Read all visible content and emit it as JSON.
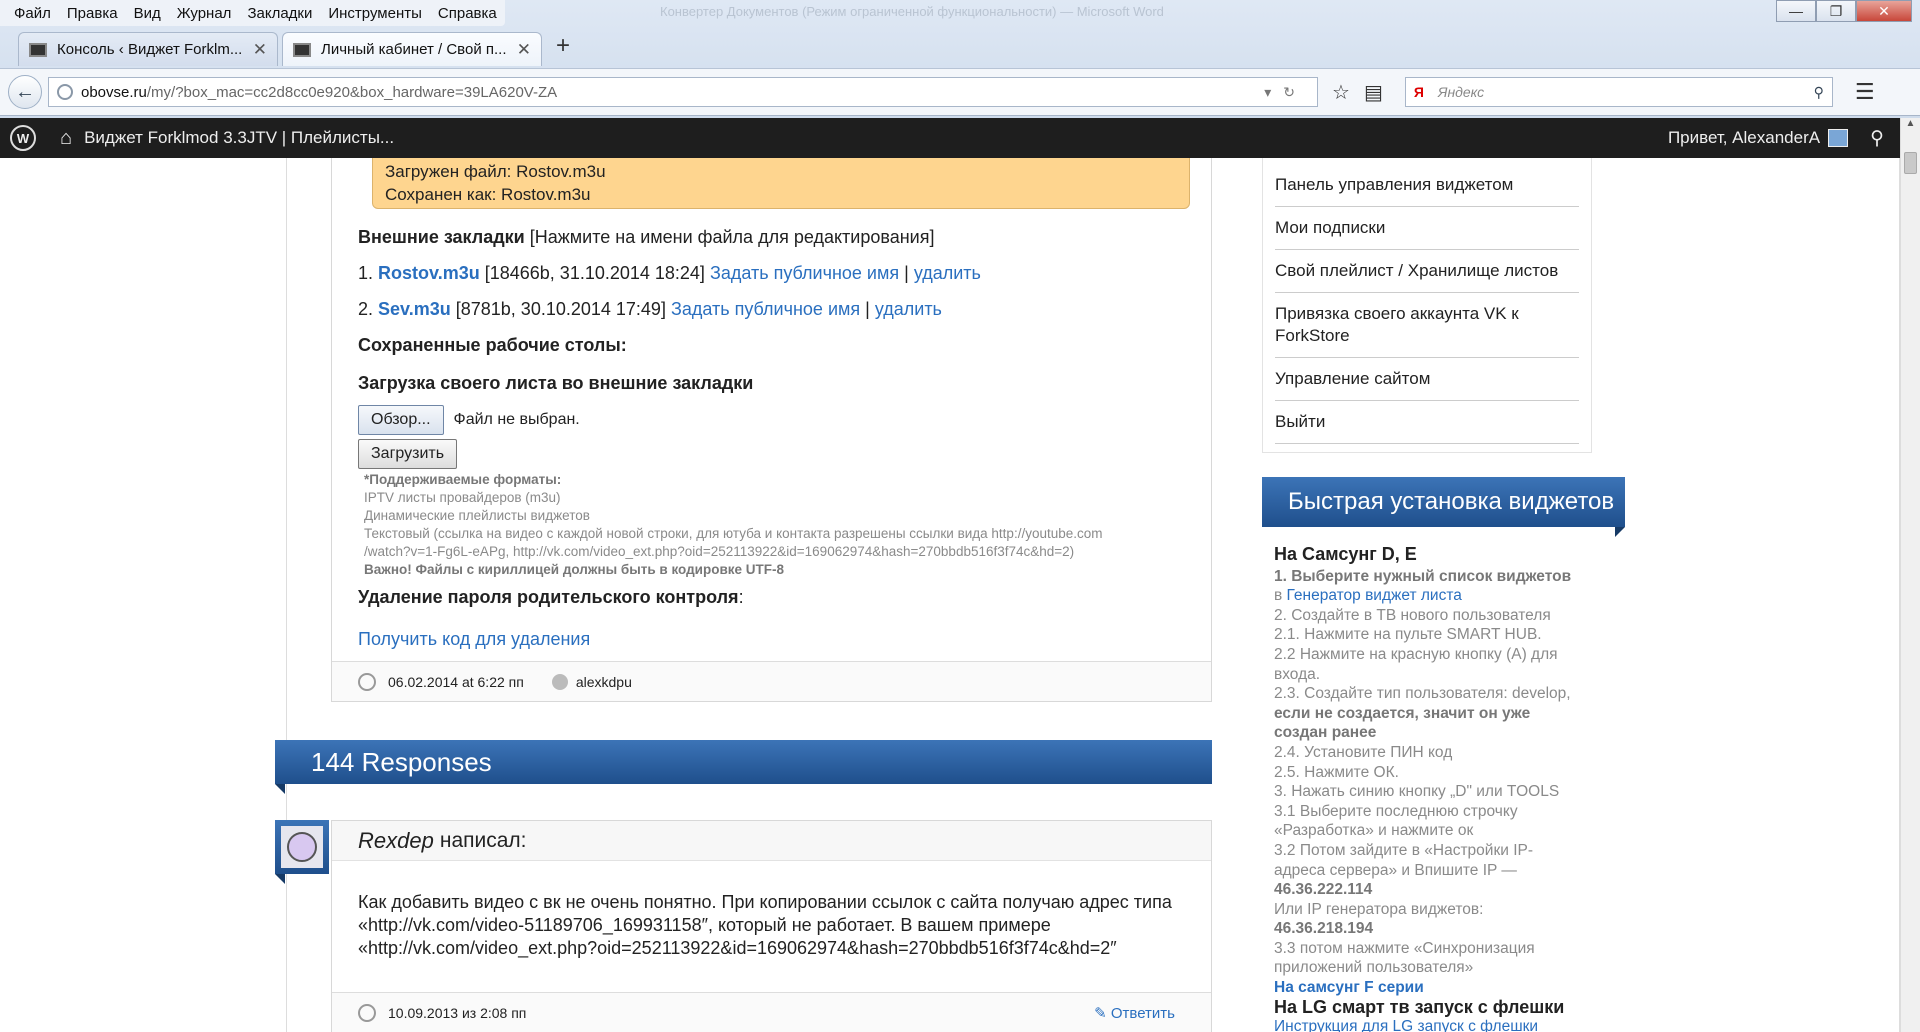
{
  "browser": {
    "menu": [
      "Файл",
      "Правка",
      "Вид",
      "Журнал",
      "Закладки",
      "Инструменты",
      "Справка"
    ],
    "window_title": "Конвертер Документов (Режим ограниченной функциональности) — Microsoft Word",
    "tabs": [
      {
        "label": "Консоль ‹ Виджет Forklm..."
      },
      {
        "label": "Личный кабинет / Свой п..."
      }
    ],
    "url_domain": "obovse.ru",
    "url_path": "/my/?box_mac=cc2d8cc0e920&box_hardware=39LA620V-ZA",
    "search_engine_label": "Я",
    "search_placeholder": "Яндекс"
  },
  "wpbar": {
    "site_name": "Виджет Forklmod 3.3JTV | Плейлисты...",
    "greeting": "Привет, AlexanderA"
  },
  "post": {
    "notice_line1": "Загружен файл: Rostov.m3u",
    "notice_line2": "Сохранен как: Rostov.m3u",
    "ext_bookmarks_title": "Внешние закладки",
    "ext_bookmarks_hint": "[Нажмите на имени файла для редактирования]",
    "files": [
      {
        "num": "1.",
        "name": "Rostov.m3u",
        "info": "[18466b, 31.10.2014 18:24]",
        "public": "Задать публичное имя",
        "sep": "|",
        "delete": "удалить"
      },
      {
        "num": "2.",
        "name": "Sev.m3u",
        "info": "[8781b, 30.10.2014 17:49]",
        "public": "Задать публичное имя",
        "sep": "|",
        "delete": "удалить"
      }
    ],
    "saved_desktops": "Сохраненные рабочие столы:",
    "upload_title": "Загрузка своего листа во внешние закладки",
    "browse_label": "Обзор...",
    "no_file": "Файл не выбран.",
    "upload_label": "Загрузить",
    "formats_title": "*Поддерживаемые форматы:",
    "formats": [
      "IPTV листы провайдеров (m3u)",
      "Динамические плейлисты виджетов",
      "Текстовый (ссылка на видео с каждой новой строки, для ютуба и контакта разрешены ссылки вида http://youtube.com",
      "/watch?v=1-Fg6L-eAPg, http://vk.com/video_ext.php?oid=252113922&id=169062974&hash=270bbdb516f3f74c&hd=2)"
    ],
    "formats_warning": "Важно! Файлы с кириллицей должны быть в кодировке UTF-8",
    "parental_title": "Удаление пароля родительского контроля",
    "parental_colon": ":",
    "get_code": "Получить код для удаления",
    "date": "06.02.2014 at 6:22 пп",
    "author": "alexkdpu"
  },
  "responses_title": "144 Responses",
  "comment": {
    "author": "Rexdep",
    "wrote": "написал:",
    "text": "Как добавить видео с вк не очень понятно. При копировании ссылок с сайта получаю адрес типа «http://vk.com/video-51189706_169931158″, который не работает. В вашем примере «http://vk.com/video_ext.php?oid=252113922&id=169062974&hash=270bbdb516f3f74c&hd=2″",
    "date": "10.09.2013 из 2:08 пп",
    "reply": "Ответить"
  },
  "sidebar": {
    "menu": [
      "Панель управления виджетом",
      "Мои подписки",
      "Свой плейлист / Хранилище листов",
      "Привязка своего аккаунта VK к ForkStore",
      "Управление сайтом",
      "Выйти"
    ],
    "quick_install_title": "Быстрая установка виджетов",
    "samsung_title": "На Самсунг D, E",
    "step1": "1. Выберите нужный список виджетов",
    "step1b_pre": "в",
    "step1b_link": "Генератор виджет листа",
    "step2": "2. Создайте в ТВ нового пользователя",
    "step21": "2.1. Нажмите на пульте SMART HUB.",
    "step22": "2.2 Нажмите на красную кнопку (А) для входа.",
    "step23": "2.3. Создайте тип пользователя: develop,",
    "step23b": "если не создается, значит он уже создан ранее",
    "step24": "2.4. Установите ПИН код",
    "step25": "2.5. Нажмите ОК.",
    "step3": "3. Нажать синию кнопку „D\" или TOOLS",
    "step31": "3.1 Выберите последнюю строчку «Разработка» и нажмите ок",
    "step32": "3.2 Потом зайдите в «Настройки IP-адреса сервера» и Впишите IP —",
    "ip1": "46.36.222.114",
    "or_ip": "Или IP генератора виджетов:",
    "ip2": "46.36.218.194",
    "step33": "3.3 потом нажмите «Синхронизация приложений пользователя»",
    "samsung_f": "На самсунг F серии",
    "lg_title": "На LG смарт тв запуск с флешки",
    "lg_link": "Инструкция для LG запуск с флешки"
  }
}
